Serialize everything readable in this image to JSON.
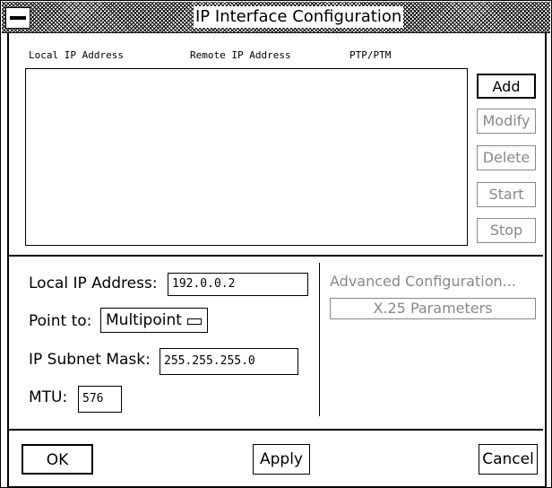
{
  "window": {
    "title": "IP Interface Configuration"
  },
  "list": {
    "columns": [
      "Local IP Address",
      "Remote IP Address",
      "PTP/PTM"
    ]
  },
  "side_buttons": {
    "add": "Add",
    "modify": "Modify",
    "delete": "Delete",
    "start": "Start",
    "stop": "Stop"
  },
  "form": {
    "local_ip_label": "Local IP Address:",
    "local_ip_value": "192.0.0.2",
    "point_to_label": "Point to:",
    "point_to_value": "Multipoint",
    "subnet_label": "IP Subnet Mask:",
    "subnet_value": "255.255.255.0",
    "mtu_label": "MTU:",
    "mtu_value": "576"
  },
  "advanced": {
    "label": "Advanced Configuration...",
    "x25_button": "X.25 Parameters"
  },
  "bottom_buttons": {
    "ok": "OK",
    "apply": "Apply",
    "cancel": "Cancel"
  }
}
